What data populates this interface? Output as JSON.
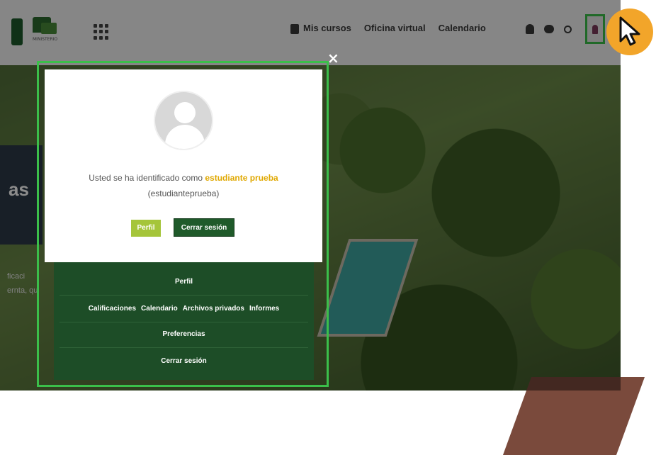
{
  "navbar": {
    "links": [
      "Mis cursos",
      "Oficina virtual",
      "Calendario"
    ],
    "logo_caption": "MINISTERIO"
  },
  "background": {
    "side_heading": "as",
    "side_lines": [
      "ficaci",
      "ernta, qu"
    ]
  },
  "modal": {
    "close_symbol": "×",
    "identified_prefix": "Usted se ha identificado como",
    "identified_name": "estudiante prueba",
    "username": "(estudianteprueba)",
    "btn_perfil": "Perfil",
    "btn_cerrar": "Cerrar sesión"
  },
  "menu": {
    "item_perfil": "Perfil",
    "row2": [
      "Calificaciones",
      "Calendario",
      "Archivos privados",
      "Informes"
    ],
    "item_preferencias": "Preferencias",
    "item_cerrar": "Cerrar sesión"
  },
  "colors": {
    "highlight": "#3bbf4a",
    "accent_yellow": "#e0a800",
    "menu_green": "#1d4d27",
    "cursor_badge": "#f2a52a"
  },
  "icons": [
    "apps-grid-icon",
    "book-icon",
    "bell-icon",
    "chat-icon",
    "search-icon",
    "user-icon",
    "pointer-cursor-icon",
    "avatar-placeholder-icon"
  ]
}
